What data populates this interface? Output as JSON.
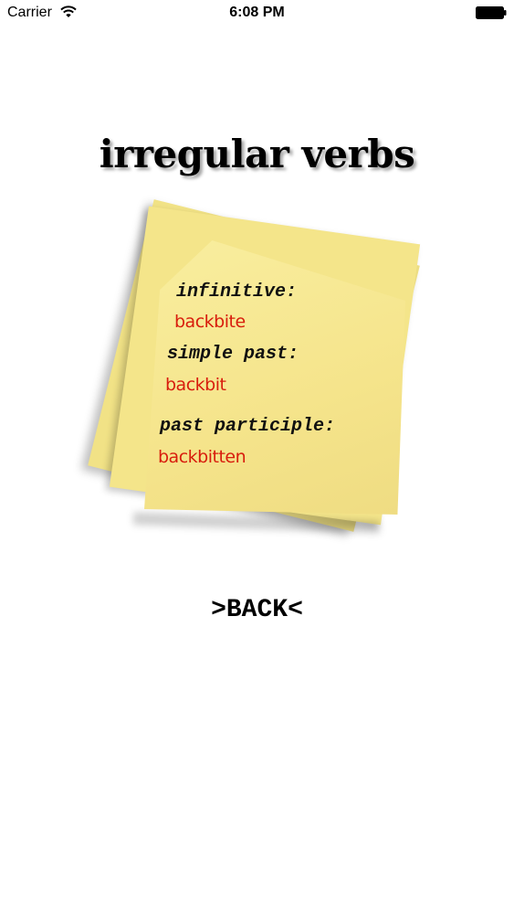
{
  "status_bar": {
    "carrier": "Carrier",
    "time": "6:08 PM",
    "icons": [
      "wifi-icon",
      "battery-icon"
    ]
  },
  "title": "irregular verbs",
  "note": {
    "infinitive_label": "infinitive:",
    "infinitive_value": "backbite",
    "simple_past_label": "simple past:",
    "simple_past_value": "backbit",
    "past_participle_label": "past participle:",
    "past_participle_value": "backbitten"
  },
  "back_button": {
    "label": ">BACK<"
  },
  "colors": {
    "value_text": "#d81d0d",
    "note_yellow": "#f6e98e"
  }
}
